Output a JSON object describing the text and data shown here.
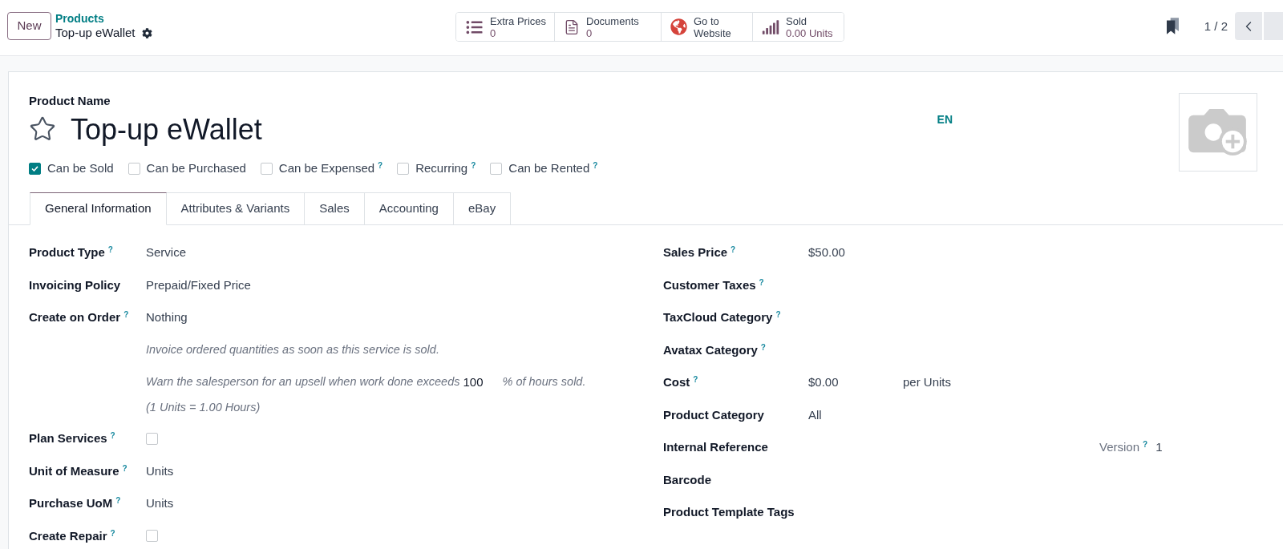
{
  "control_panel": {
    "new_button": "New",
    "breadcrumb": {
      "parent": "Products",
      "current": "Top-up eWallet"
    },
    "smart_buttons": [
      {
        "kind": "extra_prices",
        "label": "Extra Prices",
        "value": "0"
      },
      {
        "kind": "documents",
        "label": "Documents",
        "value": "0"
      },
      {
        "kind": "website",
        "label": "Go to Website"
      },
      {
        "kind": "sold",
        "label": "Sold",
        "value": "0.00 Units"
      }
    ],
    "pager": "1 / 2"
  },
  "product": {
    "name_label": "Product Name",
    "name": "Top-up eWallet",
    "favorite": false,
    "language": "EN",
    "options": [
      {
        "label": "Can be Sold",
        "checked": true
      },
      {
        "label": "Can be Purchased",
        "checked": false
      },
      {
        "label": "Can be Expensed",
        "checked": false,
        "help": "?"
      },
      {
        "label": "Recurring",
        "checked": false,
        "help": "?"
      },
      {
        "label": "Can be Rented",
        "checked": false,
        "help": "?"
      }
    ]
  },
  "tabs": [
    {
      "label": "General Information",
      "selected": true
    },
    {
      "label": "Attributes & Variants",
      "selected": false
    },
    {
      "label": "Sales",
      "selected": false
    },
    {
      "label": "Accounting",
      "selected": false
    },
    {
      "label": "eBay",
      "selected": false
    }
  ],
  "general_information": {
    "left": [
      {
        "kind": "field",
        "label": "Product Type",
        "help": "?",
        "value": "Service"
      },
      {
        "kind": "field",
        "label": "Invoicing Policy",
        "value": "Prepaid/Fixed Price"
      },
      {
        "kind": "field",
        "label": "Create on Order",
        "help": "?",
        "value": "Nothing"
      },
      {
        "kind": "note",
        "text": "Invoice ordered quantities as soon as this service is sold."
      },
      {
        "kind": "upsell",
        "before": "Warn the salesperson for an upsell when work done exceeds",
        "value": "100",
        "after": "% of hours sold.",
        "ratio": "(1 Units = 1.00 Hours)"
      },
      {
        "kind": "checkbox",
        "label": "Plan Services",
        "help": "?",
        "checked": false
      },
      {
        "kind": "field",
        "label": "Unit of Measure",
        "help": "?",
        "value": "Units"
      },
      {
        "kind": "field",
        "label": "Purchase UoM",
        "help": "?",
        "value": "Units"
      },
      {
        "kind": "checkbox",
        "label": "Create Repair",
        "help": "?",
        "checked": false
      }
    ],
    "right": [
      {
        "kind": "field",
        "label": "Sales Price",
        "help": "?",
        "value": "$50.00"
      },
      {
        "kind": "field",
        "label": "Customer Taxes",
        "help": "?"
      },
      {
        "kind": "field",
        "label": "TaxCloud Category",
        "help": "?"
      },
      {
        "kind": "field",
        "label": "Avatax Category",
        "help": "?"
      },
      {
        "kind": "cost",
        "label": "Cost",
        "help": "?",
        "value": "$0.00",
        "unit": "per Units"
      },
      {
        "kind": "field",
        "label": "Product Category",
        "value": "All"
      },
      {
        "kind": "reference",
        "label": "Internal Reference",
        "version_label": "Version",
        "version_help": "?",
        "version": "1"
      },
      {
        "kind": "field",
        "label": "Barcode"
      },
      {
        "kind": "field",
        "label": "Product Template Tags"
      }
    ]
  }
}
